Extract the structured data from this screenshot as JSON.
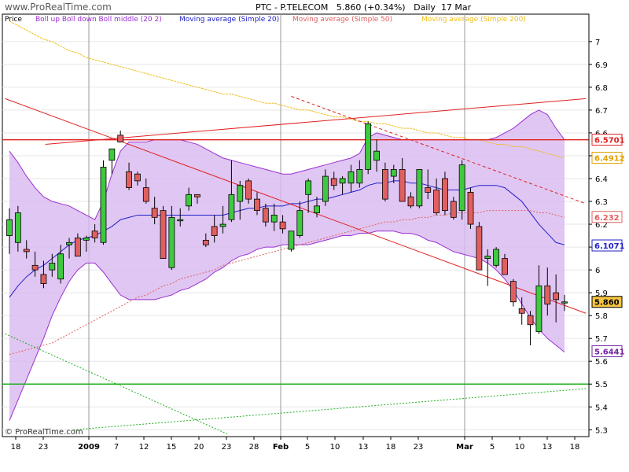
{
  "header": {
    "site": "www.ProRealTime.com",
    "instrument": "PTC - P.TELECOM",
    "last": "5.860 (+0.34%)",
    "period": "Daily",
    "date": "17 Mar",
    "copyright": "© ProRealTime.com"
  },
  "colors": {
    "up_candle": "#3ec93e",
    "down_candle": "#e06060",
    "bollinger_fill": "#d8b8f0",
    "bollinger_line": "#9b30d0",
    "ma20": "#2020c8",
    "ma50": "#e06060",
    "ma200": "#f0c020",
    "trend_red": "#e02020",
    "trend_green": "#20b020"
  },
  "chart_data": {
    "type": "candlestick",
    "title": "PTC - P.TELECOM 5.860 (+0.34%) Daily 17 Mar",
    "legend": [
      {
        "label": "Price",
        "color": "#000000"
      },
      {
        "label": "Boll up Boll down Boll middle (20 2)",
        "color": "#9b30d0"
      },
      {
        "label": "Moving average (Simple 20)",
        "color": "#2020c8"
      },
      {
        "label": "Moving average (Simple 50)",
        "color": "#e06060"
      },
      {
        "label": "Moving average (Simple 200)",
        "color": "#f0c020"
      }
    ],
    "x_ticks": [
      "18",
      "23",
      "2009",
      "7",
      "12",
      "15",
      "20",
      "23",
      "28",
      "Feb",
      "5",
      "10",
      "13",
      "18",
      "23",
      "Mar",
      "5",
      "10",
      "13",
      "18"
    ],
    "ylim": [
      5.27,
      7.12
    ],
    "y_ticks": [
      7,
      6.9,
      6.8,
      6.7,
      6.6,
      6.5,
      6.4,
      6.3,
      6.2,
      6.1,
      6,
      5.9,
      5.8,
      5.7,
      5.6,
      5.5,
      5.4,
      5.3
    ],
    "candles": [
      {
        "o": 6.15,
        "h": 6.27,
        "l": 6.07,
        "c": 6.22
      },
      {
        "o": 6.12,
        "h": 6.28,
        "l": 6.08,
        "c": 6.25
      },
      {
        "o": 6.09,
        "h": 6.13,
        "l": 6.05,
        "c": 6.08
      },
      {
        "o": 6.02,
        "h": 6.08,
        "l": 5.97,
        "c": 6.0
      },
      {
        "o": 5.98,
        "h": 6.04,
        "l": 5.92,
        "c": 5.94
      },
      {
        "o": 6.0,
        "h": 6.07,
        "l": 5.97,
        "c": 6.03
      },
      {
        "o": 5.96,
        "h": 6.11,
        "l": 5.94,
        "c": 6.07
      },
      {
        "o": 6.11,
        "h": 6.14,
        "l": 6.05,
        "c": 6.12
      },
      {
        "o": 6.14,
        "h": 6.16,
        "l": 6.06,
        "c": 6.06
      },
      {
        "o": 6.13,
        "h": 6.15,
        "l": 6.08,
        "c": 6.14
      },
      {
        "o": 6.17,
        "h": 6.2,
        "l": 6.12,
        "c": 6.14
      },
      {
        "o": 6.12,
        "h": 6.48,
        "l": 6.11,
        "c": 6.45
      },
      {
        "o": 6.48,
        "h": 6.53,
        "l": 6.42,
        "c": 6.53
      },
      {
        "o": 6.59,
        "h": 6.61,
        "l": 6.56,
        "c": 6.56
      },
      {
        "o": 6.43,
        "h": 6.47,
        "l": 6.35,
        "c": 6.36
      },
      {
        "o": 6.42,
        "h": 6.43,
        "l": 6.37,
        "c": 6.39
      },
      {
        "o": 6.36,
        "h": 6.4,
        "l": 6.29,
        "c": 6.3
      },
      {
        "o": 6.27,
        "h": 6.32,
        "l": 6.2,
        "c": 6.23
      },
      {
        "o": 6.26,
        "h": 6.28,
        "l": 6.05,
        "c": 6.05
      },
      {
        "o": 6.01,
        "h": 6.28,
        "l": 6.0,
        "c": 6.23
      },
      {
        "o": 6.22,
        "h": 6.27,
        "l": 6.19,
        "c": 6.22
      },
      {
        "o": 6.28,
        "h": 6.36,
        "l": 6.26,
        "c": 6.33
      },
      {
        "o": 6.33,
        "h": 6.33,
        "l": 6.29,
        "c": 6.32
      },
      {
        "o": 6.13,
        "h": 6.16,
        "l": 6.1,
        "c": 6.11
      },
      {
        "o": 6.19,
        "h": 6.24,
        "l": 6.12,
        "c": 6.15
      },
      {
        "o": 6.19,
        "h": 6.28,
        "l": 6.16,
        "c": 6.2
      },
      {
        "o": 6.22,
        "h": 6.48,
        "l": 6.21,
        "c": 6.33
      },
      {
        "o": 6.3,
        "h": 6.39,
        "l": 6.22,
        "c": 6.37
      },
      {
        "o": 6.39,
        "h": 6.4,
        "l": 6.29,
        "c": 6.31
      },
      {
        "o": 6.31,
        "h": 6.34,
        "l": 6.24,
        "c": 6.26
      },
      {
        "o": 6.27,
        "h": 6.29,
        "l": 6.19,
        "c": 6.21
      },
      {
        "o": 6.21,
        "h": 6.29,
        "l": 6.17,
        "c": 6.24
      },
      {
        "o": 6.21,
        "h": 6.24,
        "l": 6.16,
        "c": 6.18
      },
      {
        "o": 6.09,
        "h": 6.13,
        "l": 6.08,
        "c": 6.17
      },
      {
        "o": 6.15,
        "h": 6.3,
        "l": 6.14,
        "c": 6.26
      },
      {
        "o": 6.33,
        "h": 6.4,
        "l": 6.25,
        "c": 6.39
      },
      {
        "o": 6.25,
        "h": 6.32,
        "l": 6.23,
        "c": 6.28
      },
      {
        "o": 6.3,
        "h": 6.44,
        "l": 6.28,
        "c": 6.41
      },
      {
        "o": 6.4,
        "h": 6.43,
        "l": 6.35,
        "c": 6.37
      },
      {
        "o": 6.38,
        "h": 6.41,
        "l": 6.33,
        "c": 6.4
      },
      {
        "o": 6.38,
        "h": 6.46,
        "l": 6.34,
        "c": 6.43
      },
      {
        "o": 6.38,
        "h": 6.48,
        "l": 6.36,
        "c": 6.44
      },
      {
        "o": 6.44,
        "h": 6.65,
        "l": 6.42,
        "c": 6.64
      },
      {
        "o": 6.48,
        "h": 6.57,
        "l": 6.43,
        "c": 6.52
      },
      {
        "o": 6.44,
        "h": 6.47,
        "l": 6.3,
        "c": 6.31
      },
      {
        "o": 6.41,
        "h": 6.46,
        "l": 6.38,
        "c": 6.44
      },
      {
        "o": 6.44,
        "h": 6.49,
        "l": 6.3,
        "c": 6.3
      },
      {
        "o": 6.32,
        "h": 6.34,
        "l": 6.27,
        "c": 6.28
      },
      {
        "o": 6.28,
        "h": 6.44,
        "l": 6.27,
        "c": 6.44
      },
      {
        "o": 6.36,
        "h": 6.44,
        "l": 6.31,
        "c": 6.34
      },
      {
        "o": 6.35,
        "h": 6.4,
        "l": 6.24,
        "c": 6.25
      },
      {
        "o": 6.4,
        "h": 6.43,
        "l": 6.24,
        "c": 6.26
      },
      {
        "o": 6.3,
        "h": 6.32,
        "l": 6.22,
        "c": 6.23
      },
      {
        "o": 6.26,
        "h": 6.48,
        "l": 6.22,
        "c": 6.46
      },
      {
        "o": 6.34,
        "h": 6.36,
        "l": 6.18,
        "c": 6.2
      },
      {
        "o": 6.19,
        "h": 6.21,
        "l": 6.0,
        "c": 6.0
      },
      {
        "o": 6.05,
        "h": 6.09,
        "l": 5.93,
        "c": 6.06
      },
      {
        "o": 6.02,
        "h": 6.1,
        "l": 6.01,
        "c": 6.09
      },
      {
        "o": 6.05,
        "h": 6.07,
        "l": 5.98,
        "c": 5.98
      },
      {
        "o": 5.95,
        "h": 5.96,
        "l": 5.84,
        "c": 5.86
      },
      {
        "o": 5.83,
        "h": 5.88,
        "l": 5.76,
        "c": 5.81
      },
      {
        "o": 5.8,
        "h": 5.82,
        "l": 5.67,
        "c": 5.76
      },
      {
        "o": 5.73,
        "h": 6.02,
        "l": 5.72,
        "c": 5.93
      },
      {
        "o": 5.93,
        "h": 6.01,
        "l": 5.8,
        "c": 5.85
      },
      {
        "o": 5.9,
        "h": 5.98,
        "l": 5.77,
        "c": 5.87
      },
      {
        "o": 5.86,
        "h": 5.89,
        "l": 5.82,
        "c": 5.86
      }
    ],
    "bollinger_up": [
      6.52,
      6.47,
      6.41,
      6.36,
      6.32,
      6.3,
      6.29,
      6.28,
      6.26,
      6.24,
      6.22,
      6.3,
      6.42,
      6.52,
      6.56,
      6.56,
      6.56,
      6.57,
      6.57,
      6.57,
      6.57,
      6.56,
      6.55,
      6.53,
      6.51,
      6.49,
      6.48,
      6.47,
      6.46,
      6.45,
      6.44,
      6.43,
      6.42,
      6.42,
      6.43,
      6.44,
      6.45,
      6.46,
      6.47,
      6.48,
      6.49,
      6.51,
      6.58,
      6.6,
      6.59,
      6.58,
      6.57,
      6.57,
      6.57,
      6.57,
      6.57,
      6.57,
      6.57,
      6.57,
      6.57,
      6.57,
      6.57,
      6.58,
      6.6,
      6.62,
      6.65,
      6.68,
      6.7,
      6.68,
      6.62,
      6.57
    ],
    "bollinger_down": [
      5.34,
      5.43,
      5.52,
      5.61,
      5.7,
      5.8,
      5.88,
      5.95,
      6.0,
      6.03,
      6.03,
      5.99,
      5.94,
      5.89,
      5.87,
      5.87,
      5.87,
      5.87,
      5.88,
      5.89,
      5.91,
      5.92,
      5.94,
      5.96,
      5.99,
      6.01,
      6.04,
      6.06,
      6.07,
      6.09,
      6.1,
      6.1,
      6.11,
      6.11,
      6.11,
      6.11,
      6.12,
      6.13,
      6.14,
      6.15,
      6.15,
      6.16,
      6.16,
      6.17,
      6.17,
      6.17,
      6.16,
      6.16,
      6.15,
      6.13,
      6.12,
      6.1,
      6.08,
      6.07,
      6.06,
      6.05,
      6.03,
      6.0,
      5.96,
      5.91,
      5.85,
      5.79,
      5.74,
      5.7,
      5.67,
      5.64
    ],
    "bollinger_mid": [
      5.88,
      5.93,
      5.97,
      6.0,
      6.02,
      6.05,
      6.08,
      6.11,
      6.13,
      6.14,
      6.15,
      6.17,
      6.19,
      6.22,
      6.23,
      6.24,
      6.24,
      6.24,
      6.24,
      6.24,
      6.24,
      6.24,
      6.24,
      6.24,
      6.24,
      6.24,
      6.25,
      6.26,
      6.27,
      6.27,
      6.28,
      6.28,
      6.28,
      6.29,
      6.29,
      6.3,
      6.31,
      6.31,
      6.32,
      6.33,
      6.34,
      6.35,
      6.37,
      6.38,
      6.38,
      6.39,
      6.39,
      6.38,
      6.38,
      6.37,
      6.36,
      6.35,
      6.35,
      6.35,
      6.36,
      6.37,
      6.37,
      6.37,
      6.36,
      6.33,
      6.3,
      6.25,
      6.2,
      6.16,
      6.12,
      6.11
    ],
    "ma50": [
      5.63,
      5.64,
      5.65,
      5.66,
      5.67,
      5.68,
      5.7,
      5.72,
      5.74,
      5.76,
      5.78,
      5.8,
      5.82,
      5.84,
      5.86,
      5.88,
      5.89,
      5.91,
      5.93,
      5.94,
      5.96,
      5.97,
      5.98,
      5.99,
      6.0,
      6.02,
      6.03,
      6.04,
      6.05,
      6.06,
      6.07,
      6.08,
      6.09,
      6.1,
      6.11,
      6.12,
      6.13,
      6.14,
      6.15,
      6.16,
      6.17,
      6.18,
      6.19,
      6.2,
      6.21,
      6.21,
      6.22,
      6.22,
      6.23,
      6.23,
      6.24,
      6.24,
      6.25,
      6.25,
      6.25,
      6.25,
      6.26,
      6.26,
      6.26,
      6.26,
      6.26,
      6.26,
      6.25,
      6.25,
      6.24,
      6.23
    ],
    "ma200": [
      7.09,
      7.07,
      7.05,
      7.03,
      7.01,
      7.0,
      6.98,
      6.96,
      6.95,
      6.93,
      6.92,
      6.91,
      6.9,
      6.89,
      6.88,
      6.87,
      6.86,
      6.85,
      6.84,
      6.83,
      6.82,
      6.81,
      6.8,
      6.79,
      6.78,
      6.77,
      6.77,
      6.76,
      6.75,
      6.74,
      6.73,
      6.73,
      6.72,
      6.71,
      6.7,
      6.7,
      6.69,
      6.68,
      6.67,
      6.67,
      6.66,
      6.65,
      6.65,
      6.64,
      6.64,
      6.63,
      6.62,
      6.62,
      6.61,
      6.6,
      6.6,
      6.59,
      6.58,
      6.58,
      6.57,
      6.57,
      6.56,
      6.55,
      6.55,
      6.54,
      6.54,
      6.53,
      6.52,
      6.51,
      6.5,
      6.49
    ],
    "trendlines": [
      {
        "color": "#e02020",
        "style": "solid",
        "i0": -0.5,
        "y0": 6.75,
        "i1": 67.5,
        "y1": 5.81
      },
      {
        "color": "#e02020",
        "style": "solid",
        "i0": 4.2,
        "y0": 6.55,
        "i1": 67.5,
        "y1": 6.75
      },
      {
        "color": "#e02020",
        "style": "dashed",
        "i0": 33,
        "y0": 6.76,
        "i1": 67.5,
        "y1": 6.29
      },
      {
        "color": "#20b020",
        "style": "dotted",
        "i0": -0.5,
        "y0": 5.72,
        "i1": 25.6,
        "y1": 5.28
      },
      {
        "color": "#20b020",
        "style": "dotted",
        "i0": 7.5,
        "y0": 5.3,
        "i1": 67.5,
        "y1": 5.48
      }
    ],
    "hlines": [
      {
        "y": 6.57,
        "color": "#e02020"
      },
      {
        "y": 5.5,
        "color": "#20b020"
      }
    ],
    "value_labels": [
      {
        "label": "6.5701",
        "y": 6.5701,
        "fg": "#e02020",
        "bg": "#ffffff",
        "border": "#e02020"
      },
      {
        "label": "6.4912",
        "y": 6.4912,
        "fg": "#e0a000",
        "bg": "#ffffff",
        "border": "#e0a000"
      },
      {
        "label": "6.232",
        "y": 6.232,
        "fg": "#e06060",
        "bg": "#ffffff",
        "border": "#e06060"
      },
      {
        "label": "6.1071",
        "y": 6.1071,
        "fg": "#2020c8",
        "bg": "#ffffff",
        "border": "#2020c8"
      },
      {
        "label": "5.860",
        "y": 5.86,
        "fg": "#000000",
        "bg": "#f5c542",
        "border": "#000000"
      },
      {
        "label": "5.6441",
        "y": 5.6441,
        "fg": "#7020a0",
        "bg": "#ffffff",
        "border": "#7020a0"
      }
    ]
  }
}
